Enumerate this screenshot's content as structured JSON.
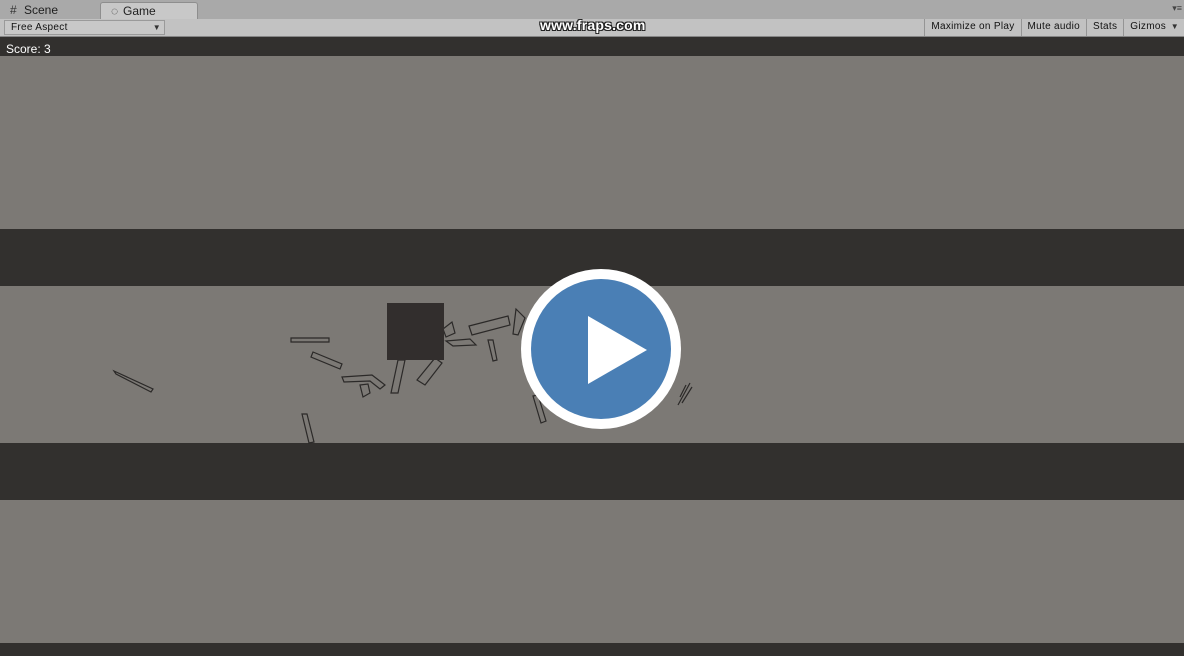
{
  "tabs": [
    {
      "label": "Scene",
      "icon": "grid-icon",
      "active": false
    },
    {
      "label": "Game",
      "icon": "game-icon",
      "active": true
    }
  ],
  "toolbar": {
    "aspect_label": "Free Aspect",
    "maximize_label": "Maximize on Play",
    "mute_label": "Mute audio",
    "stats_label": "Stats",
    "gizmos_label": "Gizmos"
  },
  "watermark": "www.fraps.com",
  "game": {
    "score_text": "Score: 3"
  },
  "colors": {
    "background": "#7c7975",
    "band": "#32302e",
    "player": "#322e2d",
    "play_button": "#4a7fb5"
  }
}
